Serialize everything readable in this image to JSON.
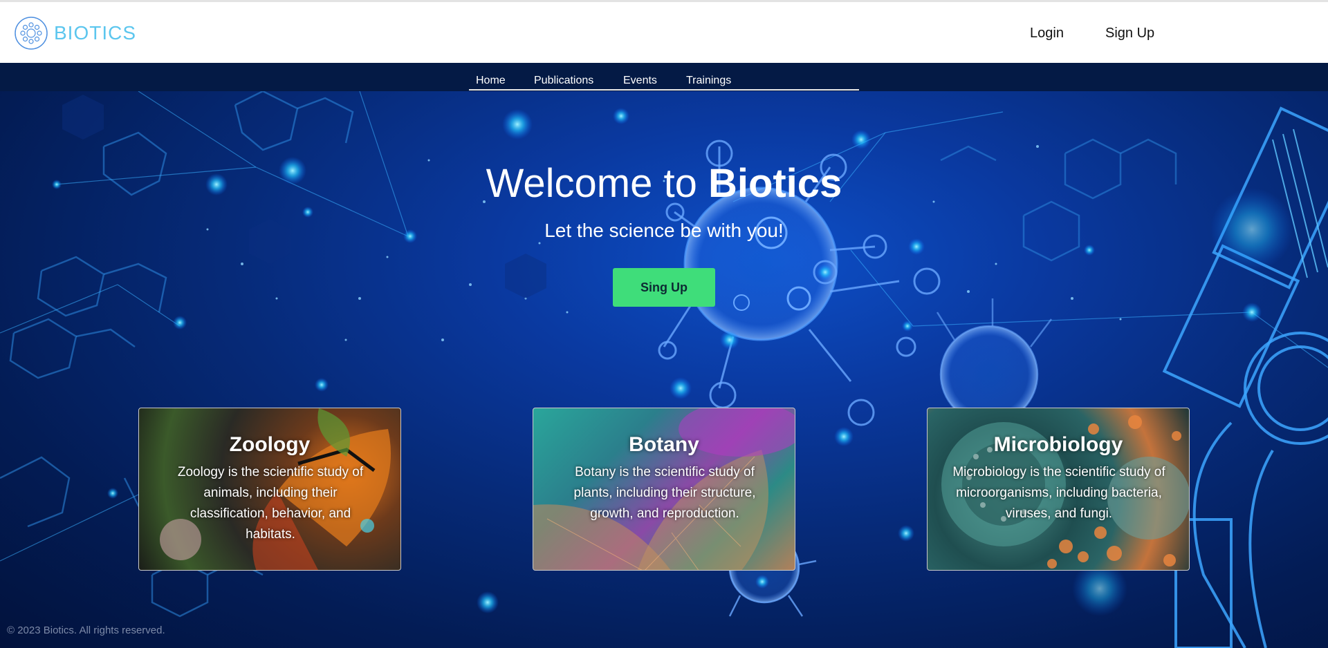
{
  "header": {
    "logo_text": "BIOTICS",
    "login_label": "Login",
    "signup_label": "Sign Up"
  },
  "nav": {
    "items": [
      {
        "label": "Home"
      },
      {
        "label": "Publications"
      },
      {
        "label": "Events"
      },
      {
        "label": "Trainings"
      }
    ]
  },
  "hero": {
    "title_prefix": "Welcome to ",
    "title_brand": "Biotics",
    "subtitle": "Let the science be with you!",
    "cta_label": "Sing Up"
  },
  "cards": [
    {
      "title": "Zoology",
      "description": "Zoology is the scientific study of animals, including their classification, behavior, and habitats."
    },
    {
      "title": "Botany",
      "description": "Botany is the scientific study of plants, including their structure, growth, and reproduction."
    },
    {
      "title": "Microbiology",
      "description": "Microbiology is the scientific study of microorganisms, including bacteria, viruses, and fungi."
    }
  ],
  "footer": {
    "copyright": "© 2023 Biotics. All rights reserved."
  },
  "colors": {
    "accent_logo": "#5cc6ee",
    "cta_green": "#3fdd7a",
    "nav_bg": "#041a45"
  }
}
